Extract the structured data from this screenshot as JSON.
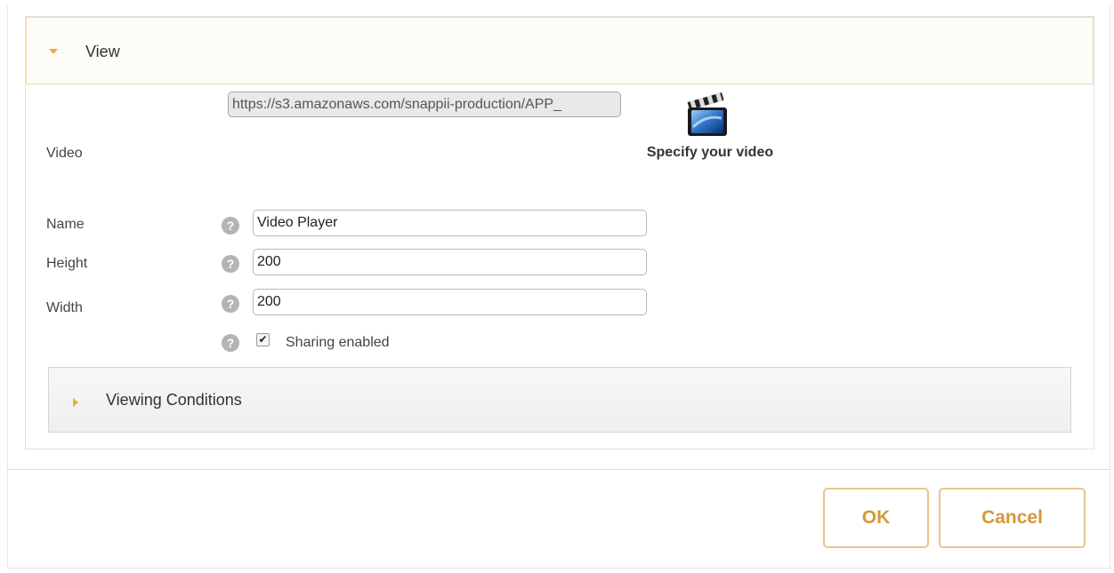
{
  "view_section": {
    "title": "View"
  },
  "video": {
    "label": "Video",
    "url": "https://s3.amazonaws.com/snappii-production/APP_",
    "specify_text": "Specify your video",
    "icon": "video-clapperboard-icon"
  },
  "fields": {
    "name": {
      "label": "Name",
      "value": "Video Player"
    },
    "height": {
      "label": "Height",
      "value": "200"
    },
    "width": {
      "label": "Width",
      "value": "200"
    }
  },
  "sharing": {
    "label": "Sharing enabled",
    "checked": true
  },
  "help_icon_glyph": "?",
  "viewing_conditions": {
    "title": "Viewing Conditions",
    "expanded": false
  },
  "buttons": {
    "ok": "OK",
    "cancel": "Cancel"
  },
  "colors": {
    "accent": "#f2a93b",
    "button_text": "#d5973b",
    "button_border": "#e9c48b"
  }
}
